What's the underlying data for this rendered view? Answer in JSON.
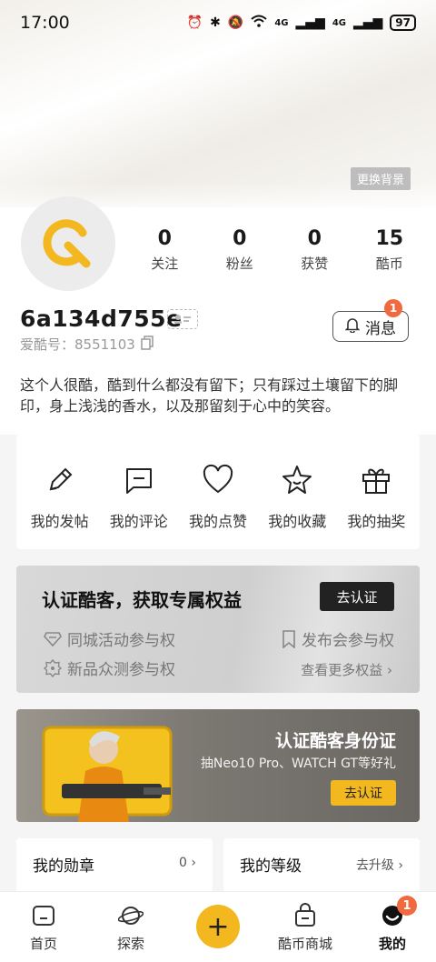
{
  "status": {
    "time": "17:00",
    "battery": "97",
    "net1": "4G",
    "net2": "4G"
  },
  "header": {
    "change_bg": "更换背景"
  },
  "stats": [
    {
      "num": "0",
      "label": "关注"
    },
    {
      "num": "0",
      "label": "粉丝"
    },
    {
      "num": "0",
      "label": "获赞"
    },
    {
      "num": "15",
      "label": "酷币"
    }
  ],
  "profile": {
    "username": "6a134d755e",
    "uid": "爱酷号：8551103",
    "message_label": "消息",
    "message_badge": "1",
    "bio": "这个人很酷，酷到什么都没有留下；只有踩过土壤留下的脚印，身上浅浅的香水，以及那留刻于心中的笑容。"
  },
  "actions": [
    {
      "label": "我的发帖",
      "icon": "pen-icon"
    },
    {
      "label": "我的评论",
      "icon": "comment-icon"
    },
    {
      "label": "我的点赞",
      "icon": "heart-icon"
    },
    {
      "label": "我的收藏",
      "icon": "star-icon"
    },
    {
      "label": "我的抽奖",
      "icon": "gift-icon"
    }
  ],
  "cert": {
    "title": "认证酷客，获取专属权益",
    "button": "去认证",
    "perks": [
      "同城活动参与权",
      "发布会参与权",
      "新品众测参与权"
    ],
    "more": "查看更多权益"
  },
  "banner": {
    "title": "认证酷客身份证",
    "subtitle": "抽Neo10 Pro、WATCH GT等好礼",
    "button": "去认证"
  },
  "cards": {
    "medal_title": "我的勋章",
    "medal_value": "0",
    "level_title": "我的等级",
    "level_value": "去升级"
  },
  "tabbar": [
    {
      "label": "首页"
    },
    {
      "label": "探索"
    },
    {
      "label": "酷币商城"
    },
    {
      "label": "我的",
      "badge": "1"
    }
  ],
  "colors": {
    "accent": "#f3b81f",
    "badge": "#f06a3f"
  }
}
